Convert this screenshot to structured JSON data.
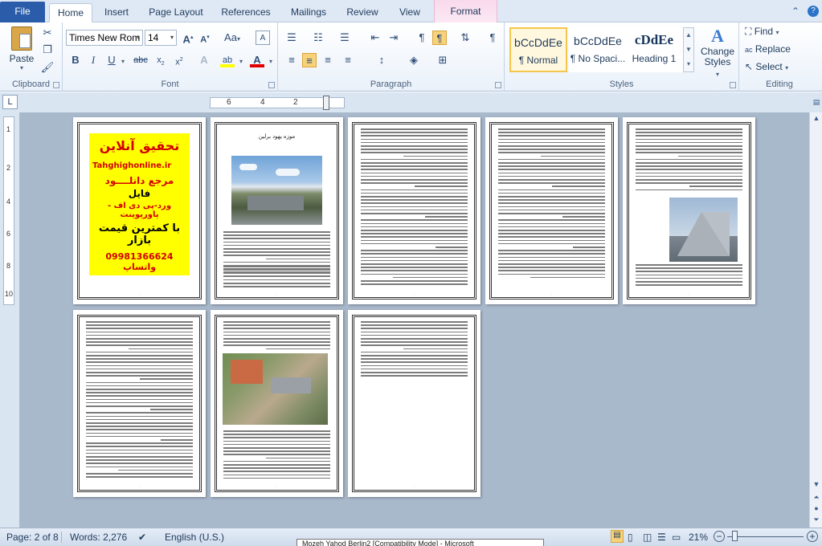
{
  "tabs": {
    "file": "File",
    "home": "Home",
    "insert": "Insert",
    "page_layout": "Page Layout",
    "references": "References",
    "mailings": "Mailings",
    "review": "Review",
    "view": "View",
    "format": "Format"
  },
  "ribbon": {
    "clipboard": {
      "label": "Clipboard",
      "paste": "Paste"
    },
    "font": {
      "label": "Font",
      "font_name": "Times New Rom",
      "font_size": "14"
    },
    "paragraph": {
      "label": "Paragraph"
    },
    "styles": {
      "label": "Styles",
      "items": [
        {
          "sample": "bCcDdEe",
          "name": "¶ Normal"
        },
        {
          "sample": "bCcDdEe",
          "name": "¶ No Spaci..."
        },
        {
          "sample": "cDdEe",
          "name": "Heading 1"
        }
      ],
      "change_styles": "Change Styles"
    },
    "editing": {
      "label": "Editing",
      "find": "Find",
      "replace": "Replace",
      "select": "Select"
    }
  },
  "ruler_marks": [
    "6",
    "4",
    "2"
  ],
  "vruler_marks": [
    "1",
    "2",
    "4",
    "6",
    "8",
    "10"
  ],
  "pages": [
    {
      "promo": {
        "title": "تحقیق آنلاین",
        "site": "Tahghighonline.ir",
        "line1": "مرجع دانلــــود",
        "line2": "فایل",
        "line3": "ورد-پی دی اف - پاورپوینت",
        "line4": "با کمترین قیمت بازار",
        "phone": "09981366624 واتساپ"
      }
    },
    {
      "heading": "موزه یهود برلین"
    }
  ],
  "status": {
    "page": "Page: 2 of 8",
    "words": "Words: 2,276",
    "language": "English (U.S.)",
    "zoom": "21%",
    "taskbar_title": "Mozeh Yahod Berlin2 [Compatibility Mode] - Microsoft"
  },
  "colors": {
    "accent": "#2a5caa",
    "promo_yellow": "#ffff00",
    "promo_red": "#d40000"
  }
}
